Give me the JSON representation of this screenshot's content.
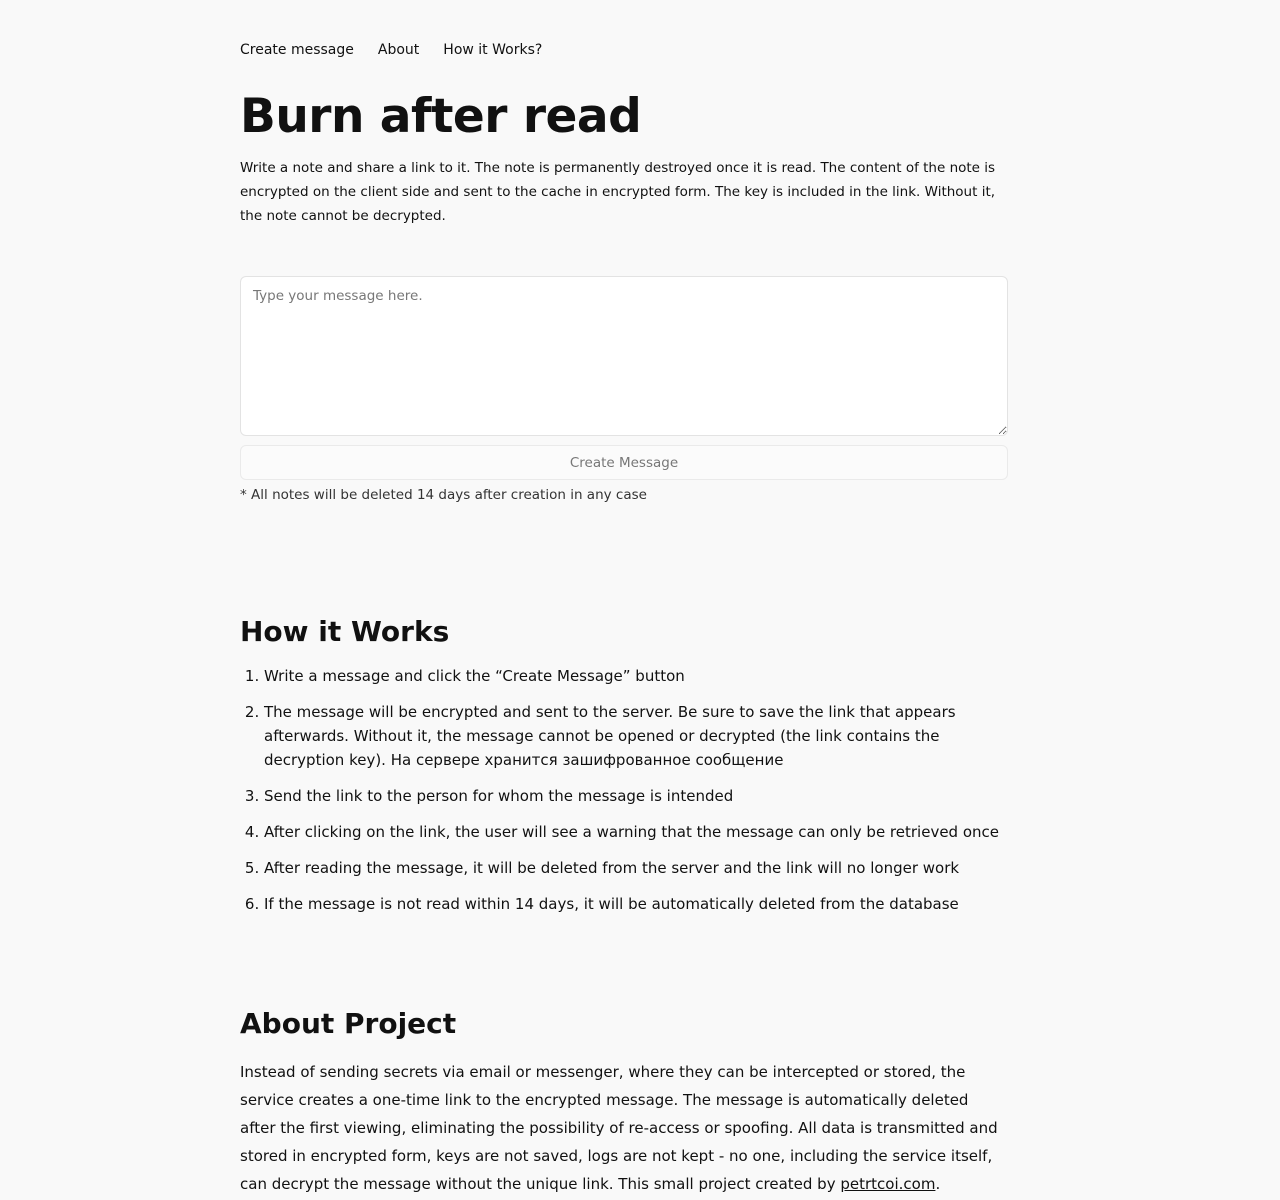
{
  "nav": {
    "items": [
      "Create message",
      "About",
      "How it Works?"
    ]
  },
  "header": {
    "title": "Burn after read",
    "intro": "Write a note and share a link to it. The note is permanently destroyed once it is read. The content of the note is encrypted on the client side and sent to the cache in encrypted form. The key is included in the link. Without it, the note cannot be decrypted."
  },
  "form": {
    "message_placeholder": "Type your message here.",
    "message_value": "",
    "button_label": "Create Message",
    "note": "* All notes will be deleted 14 days after creation in any case"
  },
  "how": {
    "title": "How it Works",
    "steps": [
      "Write a message and click the “Create Message” button",
      "The message will be encrypted and sent to the server. Be sure to save the link that appears afterwards. Without it, the message cannot be opened or decrypted (the link contains the decryption key). На сервере хранится зашифрованное сообщение",
      "Send the link to the person for whom the message is intended",
      "After clicking on the link, the user will see a warning that the message can only be retrieved once",
      "After reading the message, it will be deleted from the server and the link will no longer work",
      "If the message is not read within 14 days, it will be automatically deleted from the database"
    ]
  },
  "about": {
    "title": "About Project",
    "text": "Instead of sending secrets via email or messenger, where they can be intercepted or stored, the service creates a one-time link to the encrypted message. The message is automatically deleted after the first viewing, eliminating the possibility of re-access or spoofing. All data is transmitted and stored in encrypted form, keys are not saved, logs are not kept - no one, including the service itself, can decrypt the message without the unique link. This small project created by ",
    "link_text": "petrtcoi.com",
    "text_end": "."
  }
}
